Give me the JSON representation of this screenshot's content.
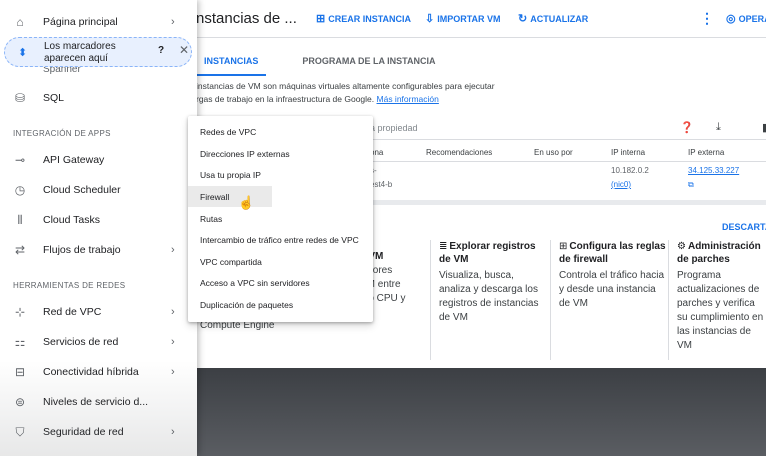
{
  "header": {
    "title": "nstancias de ...",
    "actions": [
      {
        "icon": "plus-box-icon",
        "glyph": "⊞",
        "label": "CREAR INSTANCIA"
      },
      {
        "icon": "import-icon",
        "glyph": "⇩",
        "label": "IMPORTAR VM"
      },
      {
        "icon": "refresh-icon",
        "glyph": "↻",
        "label": "ACTUALIZAR"
      }
    ],
    "kebab": "⋮",
    "operations": "OPERA"
  },
  "tabs": [
    {
      "label": "INSTANCIAS",
      "active": true
    },
    {
      "label": "PROGRAMA DE LA INSTANCIA",
      "active": false
    }
  ],
  "description": {
    "line1": "instancias de VM son máquinas virtuales altamente configurables para ejecutar",
    "line2": "rgas de trabajo en la infraestructura de Google.",
    "link": "Más información"
  },
  "filter": {
    "placeholder": "a propiedad"
  },
  "table": {
    "headers": [
      "ona",
      "Recomendaciones",
      "En uso por",
      "IP interna",
      "IP externa"
    ],
    "row": {
      "zone_partial": "s-",
      "zone_partial2": "est4-b",
      "internal_ip": "10.182.0.2",
      "nic": "(nic0)",
      "external_ip": "34.125.33.227"
    }
  },
  "dismiss": "DESCARTA",
  "cards": [
    {
      "icon": "list-icon",
      "glyph": "≣",
      "title": "Explorar registros de VM",
      "body": "Visualiza, busca, analiza y descarga los registros de instancias de VM"
    },
    {
      "icon": "grid-icon",
      "glyph": "⊞",
      "title": "Configura las reglas de firewall",
      "body": "Controla el tráfico hacia y desde una instancia de VM"
    },
    {
      "icon": "settings-icon",
      "glyph": "⚙",
      "title": "Administración de parches",
      "body": "Programa actualizaciones de parches y verifica su cumplimiento en las instancias de VM"
    }
  ],
  "partial_card": {
    "title": "a VM",
    "lines": [
      "valores",
      "VM entre",
      "mo CPU y"
    ]
  },
  "compute_engine_text": "Compute Engine",
  "drawer": {
    "home": {
      "label": "Página principal",
      "glyph": "⌂"
    },
    "pin_tooltip": {
      "text": "Los marcadores aparecen aquí",
      "help": "?",
      "close": "✕",
      "pin": "⬍"
    },
    "ghost": "Spanner",
    "sql": {
      "label": "SQL",
      "glyph": "⛁"
    },
    "section_apps": "INTEGRACIÓN DE APPS",
    "apps": [
      {
        "label": "API Gateway",
        "glyph": "⊸",
        "icon": "api-gateway-icon"
      },
      {
        "label": "Cloud Scheduler",
        "glyph": "◷",
        "icon": "clock-icon"
      },
      {
        "label": "Cloud Tasks",
        "glyph": "⦀",
        "icon": "tasks-icon"
      },
      {
        "label": "Flujos de trabajo",
        "glyph": "⇄",
        "icon": "workflows-icon",
        "chevron": true
      }
    ],
    "section_net": "HERRAMIENTAS DE REDES",
    "net": [
      {
        "label": "Red de VPC",
        "glyph": "⊹",
        "icon": "vpc-network-icon",
        "chevron": true
      },
      {
        "label": "Servicios de red",
        "glyph": "⚏",
        "icon": "network-services-icon",
        "chevron": true
      },
      {
        "label": "Conectividad híbrida",
        "glyph": "⊟",
        "icon": "hybrid-connectivity-icon",
        "chevron": true
      },
      {
        "label": "Niveles de servicio d...",
        "glyph": "⊜",
        "icon": "network-tiers-icon",
        "chevron": false
      },
      {
        "label": "Seguridad de red",
        "glyph": "⛉",
        "icon": "network-security-icon",
        "chevron": true
      }
    ],
    "chevron": "›"
  },
  "submenu": [
    {
      "label": "Redes de VPC",
      "hover": false
    },
    {
      "label": "Direcciones IP externas",
      "hover": false
    },
    {
      "label": "Usa tu propia IP",
      "hover": false
    },
    {
      "label": "Firewall",
      "hover": true
    },
    {
      "label": "Rutas",
      "hover": false
    },
    {
      "label": "Intercambio de tráfico entre redes de VPC",
      "hover": false
    },
    {
      "label": "VPC compartida",
      "hover": false
    },
    {
      "label": "Acceso a VPC sin servidores",
      "hover": false
    },
    {
      "label": "Duplicación de paquetes",
      "hover": false
    }
  ],
  "cursor": "☝"
}
